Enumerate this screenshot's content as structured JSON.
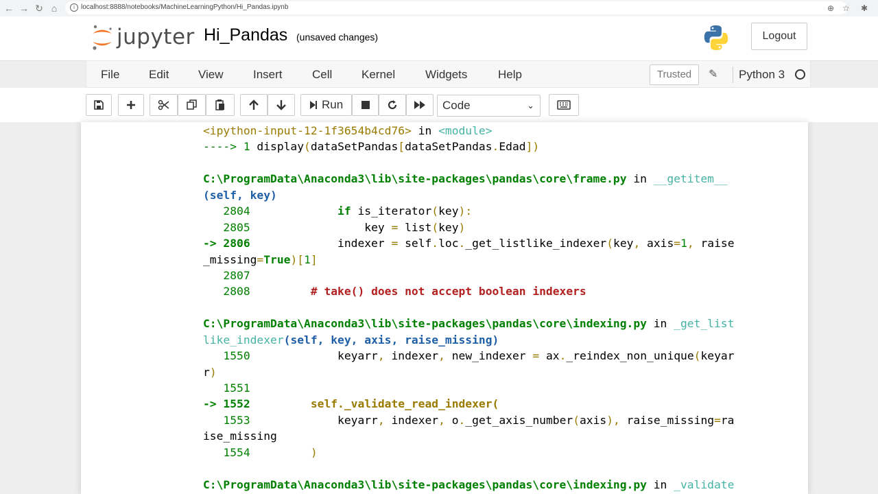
{
  "browser": {
    "url": "localhost:8888/notebooks/MachineLearningPython/Hi_Pandas.ipynb"
  },
  "header": {
    "logo_text": "jupyter",
    "notebook_name": "Hi_Pandas",
    "save_status": "(unsaved changes)",
    "logout_label": "Logout"
  },
  "menubar": {
    "items": [
      "File",
      "Edit",
      "View",
      "Insert",
      "Cell",
      "Kernel",
      "Widgets",
      "Help"
    ],
    "trusted_label": "Trusted",
    "kernel_name": "Python 3"
  },
  "toolbar": {
    "run_label": "Run",
    "cell_type": "Code",
    "icons": [
      "save-icon",
      "plus-icon",
      "cut-icon",
      "copy-icon",
      "paste-icon",
      "arrow-up-icon",
      "arrow-down-icon",
      "run-icon",
      "stop-icon",
      "restart-icon",
      "fast-forward-icon",
      "keyboard-icon"
    ]
  },
  "colors": {
    "green": "#008000",
    "blue": "#1f5fa8",
    "cyan": "#44b3a4",
    "olive": "#9a7b00",
    "red": "#b22020"
  },
  "traceback": {
    "lines": [
      [
        [
          "y",
          "<ipython-input-12-1f3654b4cd76>"
        ],
        [
          "",
          " in "
        ],
        [
          "c",
          "<module>"
        ]
      ],
      [
        [
          "g",
          "----> 1 "
        ],
        [
          "",
          "display"
        ],
        [
          "y",
          "("
        ],
        [
          "",
          "dataSetPandas"
        ],
        [
          "y",
          "["
        ],
        [
          "",
          "dataSetPandas"
        ],
        [
          "y",
          "."
        ],
        [
          "",
          "Edad"
        ],
        [
          "y",
          "])"
        ]
      ],
      [],
      [
        [
          "gb",
          "C:\\ProgramData\\Anaconda3\\lib\\site-packages\\pandas\\core\\frame.py"
        ],
        [
          "",
          " in "
        ],
        [
          "c",
          "__getitem__"
        ]
      ],
      [
        [
          "b",
          "(self, key)"
        ]
      ],
      [
        [
          "g",
          "   2804             "
        ],
        [
          "k",
          "if"
        ],
        [
          "",
          " is_iterator"
        ],
        [
          "y",
          "("
        ],
        [
          "",
          "key"
        ],
        [
          "y",
          "):"
        ]
      ],
      [
        [
          "g",
          "   2805                 "
        ],
        [
          "",
          "key "
        ],
        [
          "y",
          "="
        ],
        [
          "",
          " list"
        ],
        [
          "y",
          "("
        ],
        [
          "",
          "key"
        ],
        [
          "y",
          ")"
        ]
      ],
      [
        [
          "gb",
          "-> 2806             "
        ],
        [
          "",
          "indexer "
        ],
        [
          "y",
          "="
        ],
        [
          "",
          " self"
        ],
        [
          "y",
          "."
        ],
        [
          "",
          "loc"
        ],
        [
          "y",
          "."
        ],
        [
          "",
          "_get_listlike_indexer"
        ],
        [
          "y",
          "("
        ],
        [
          "",
          "key"
        ],
        [
          "y",
          ","
        ],
        [
          "",
          " axis"
        ],
        [
          "y",
          "="
        ],
        [
          "g",
          "1"
        ],
        [
          "y",
          ","
        ],
        [
          "",
          " raise"
        ]
      ],
      [
        [
          "",
          "_missing"
        ],
        [
          "y",
          "="
        ],
        [
          "k",
          "True"
        ],
        [
          "y",
          ")["
        ],
        [
          "g",
          "1"
        ],
        [
          "y",
          "]"
        ]
      ],
      [
        [
          "g",
          "   2807"
        ]
      ],
      [
        [
          "g",
          "   2808         "
        ],
        [
          "r",
          "# take() does not accept boolean indexers"
        ]
      ],
      [],
      [
        [
          "gb",
          "C:\\ProgramData\\Anaconda3\\lib\\site-packages\\pandas\\core\\indexing.py"
        ],
        [
          "",
          " in "
        ],
        [
          "c",
          "_get_list"
        ]
      ],
      [
        [
          "c",
          "like_indexer"
        ],
        [
          "b",
          "(self, key, axis, raise_missing)"
        ]
      ],
      [
        [
          "g",
          "   1550             "
        ],
        [
          "",
          "keyarr"
        ],
        [
          "y",
          ","
        ],
        [
          "",
          " indexer"
        ],
        [
          "y",
          ","
        ],
        [
          "",
          " new_indexer "
        ],
        [
          "y",
          "="
        ],
        [
          "",
          " ax"
        ],
        [
          "y",
          "."
        ],
        [
          "",
          "_reindex_non_unique"
        ],
        [
          "y",
          "("
        ],
        [
          "",
          "keyar"
        ]
      ],
      [
        [
          "",
          "r"
        ],
        [
          "y",
          ")"
        ]
      ],
      [
        [
          "g",
          "   1551"
        ]
      ],
      [
        [
          "gb",
          "-> 1552         "
        ],
        [
          "yb",
          "self._validate_read_indexer("
        ]
      ],
      [
        [
          "g",
          "   1553             "
        ],
        [
          "",
          "keyarr"
        ],
        [
          "y",
          ","
        ],
        [
          "",
          " indexer"
        ],
        [
          "y",
          ","
        ],
        [
          "",
          " o"
        ],
        [
          "y",
          "."
        ],
        [
          "",
          "_get_axis_number"
        ],
        [
          "y",
          "("
        ],
        [
          "",
          "axis"
        ],
        [
          "y",
          "),"
        ],
        [
          "",
          " raise_missing"
        ],
        [
          "y",
          "="
        ],
        [
          "",
          "ra"
        ]
      ],
      [
        [
          "",
          "ise_missing"
        ]
      ],
      [
        [
          "g",
          "   1554         "
        ],
        [
          "y",
          ")"
        ]
      ],
      [],
      [
        [
          "gb",
          "C:\\ProgramData\\Anaconda3\\lib\\site-packages\\pandas\\core\\indexing.py"
        ],
        [
          "",
          " in "
        ],
        [
          "c",
          "_validate"
        ]
      ]
    ]
  }
}
